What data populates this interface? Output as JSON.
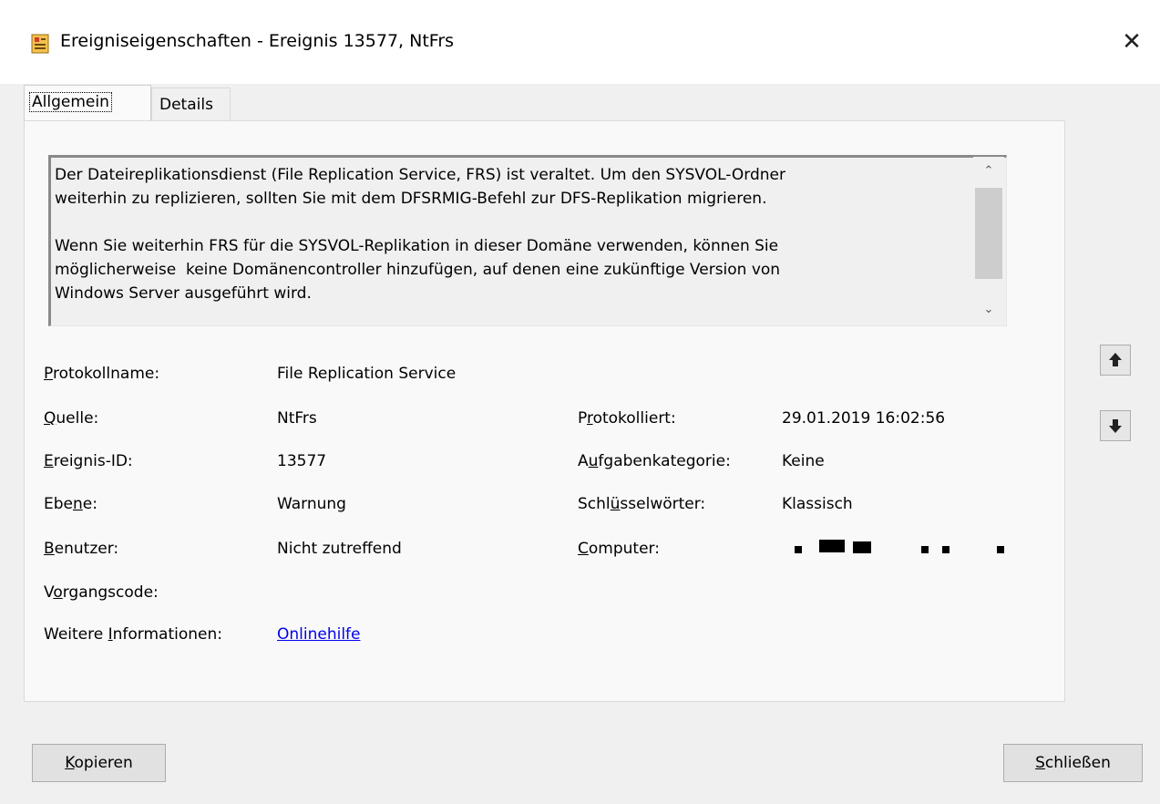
{
  "window": {
    "title": "Ereigniseigenschaften - Ereignis 13577, NtFrs",
    "icon": "event-viewer-icon",
    "close_glyph": "✕"
  },
  "tabs": [
    {
      "label": "Allgemein",
      "active": true
    },
    {
      "label": "Details",
      "active": false
    }
  ],
  "description": {
    "text": "Der Dateireplikationsdienst (File Replication Service, FRS) ist veraltet. Um den SYSVOL-Ordner\nweiterhin zu replizieren, sollten Sie mit dem DFSRMIG-Befehl zur DFS-Replikation migrieren.\n\nWenn Sie weiterhin FRS für die SYSVOL-Replikation in dieser Domäne verwenden, können Sie\nmöglicherweise  keine Domänencontroller hinzufügen, auf denen eine zukünftige Version von\nWindows Server ausgeführt wird.",
    "scroll_up": "⌃",
    "scroll_down": "⌄"
  },
  "fields": {
    "protokollname": {
      "label_pre": "",
      "label_acc": "P",
      "label_post": "rotokollname:",
      "value": "File Replication Service"
    },
    "quelle": {
      "label_pre": "",
      "label_acc": "Q",
      "label_post": "uelle:",
      "value": "NtFrs"
    },
    "ereignis_id": {
      "label_pre": "",
      "label_acc": "E",
      "label_post": "reignis-ID:",
      "value": "13577"
    },
    "ebene": {
      "label_pre": "Ebe",
      "label_acc": "n",
      "label_post": "e:",
      "value": "Warnung"
    },
    "benutzer": {
      "label_pre": "",
      "label_acc": "B",
      "label_post": "enutzer:",
      "value": "Nicht zutreffend"
    },
    "vorgangscode": {
      "label_pre": "V",
      "label_acc": "o",
      "label_post": "rgangscode:",
      "value": ""
    },
    "weitere_info": {
      "label_pre": "Weitere ",
      "label_acc": "I",
      "label_post": "nformationen:",
      "value": "Onlinehilfe"
    },
    "protokolliert": {
      "label_pre": "P",
      "label_acc": "r",
      "label_post": "otokolliert:",
      "value": "29.01.2019 16:02:56"
    },
    "aufgabenkategorie": {
      "label_pre": "A",
      "label_acc": "u",
      "label_post": "fgabenkategorie:",
      "value": "Keine"
    },
    "schluesselwoerter": {
      "label_pre": "Schl",
      "label_acc": "ü",
      "label_post": "sselwörter:",
      "value": "Klassisch"
    },
    "computer": {
      "label_pre": "",
      "label_acc": "C",
      "label_post": "omputer:",
      "value": "redacted"
    }
  },
  "buttons": {
    "copy": {
      "pre": "",
      "acc": "K",
      "post": "opieren"
    },
    "close": {
      "pre": "",
      "acc": "S",
      "post": "chließen"
    }
  },
  "nav": {
    "up": "arrow-up-icon",
    "down": "arrow-down-icon"
  },
  "colors": {
    "link": "#0000ee",
    "title_icon": "#e8a33c"
  }
}
